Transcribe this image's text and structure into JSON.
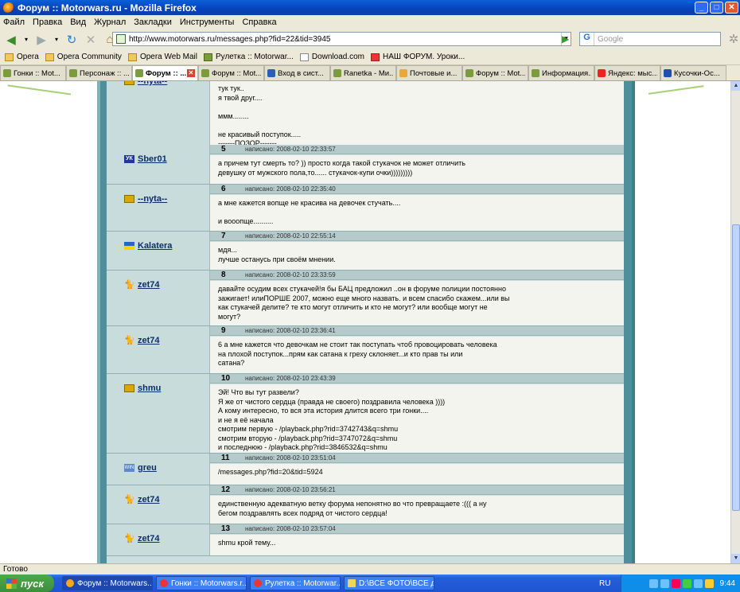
{
  "window": {
    "title": "Форум :: Motorwars.ru - Mozilla Firefox",
    "min": "_",
    "max": "□",
    "close": "✕"
  },
  "menu": [
    "Файл",
    "Правка",
    "Вид",
    "Журнал",
    "Закладки",
    "Инструменты",
    "Справка"
  ],
  "nav": {
    "url": "http://www.motorwars.ru/messages.php?fid=22&tid=3945",
    "search_placeholder": "Google",
    "search_engine": "G"
  },
  "bookmarks": [
    "Opera",
    "Opera Community",
    "Opera Web Mail",
    "Рулетка :: Motorwar...",
    "Download.com",
    "НАШ ФОРУМ. Уроки..."
  ],
  "tabs": [
    "Гонки :: Mot...",
    "Персонаж :: ...",
    "Форум :: ...",
    "Форум :: Mot...",
    "Вход в сист...",
    "Ranetka - Ми...",
    "Почтовые и...",
    "Форум :: Mot...",
    "Информация...",
    "Яндекс: мыс...",
    "Кусочки-Ос..."
  ],
  "posts": [
    {
      "user": "--nyta--",
      "flag": "u",
      "num": "",
      "date": "",
      "lines": [
        "тук тук..",
        "я твой друг....",
        "",
        "ммм........",
        "",
        "не красивый поступок.....",
        "-------ПОЗОР-------"
      ]
    },
    {
      "user": "Sber01",
      "flag": "uk",
      "num": "5",
      "date": "написано: 2008-02-10 22:33:57",
      "lines": [
        "а причем тут смерть то? )) просто когда такой стукачок не может отличить",
        "девушку от мужского пола,то...... стукачок-купи очки)))))))))"
      ]
    },
    {
      "user": "--nyta--",
      "flag": "u",
      "num": "6",
      "date": "написано: 2008-02-10 22:35:40",
      "lines": [
        "а мне кажется вопще не красива на девочек стучать....",
        "",
        "и вооопще.........."
      ]
    },
    {
      "user": "Kalatera",
      "flag": "ua",
      "num": "7",
      "date": "написано: 2008-02-10 22:55:14",
      "lines": [
        "мдя...",
        "лучше останусь при своём мнении."
      ]
    },
    {
      "user": "zet74",
      "flag": "cat",
      "num": "8",
      "date": "написано: 2008-02-10 23:33:59",
      "lines": [
        "давайте осудим всех стукачей!я бы БАЦ предложил ..он в форуме полиции постоянно",
        "зажигает! илиПОРШЕ 2007, можно еще много назвать. и всем спасибо скажем...или вы",
        "как стукачей делите? те кто могут отличить и кто не могут? или вообще могут не",
        "могут?"
      ]
    },
    {
      "user": "zet74",
      "flag": "cat",
      "num": "9",
      "date": "написано: 2008-02-10 23:36:41",
      "lines": [
        "6 а мне кажется что девочкам не стоит так поступать чтоб провоцировать человека",
        "на плохой поступок...прям как сатана к греху склоняет...и кто прав ты или",
        "сатана?"
      ]
    },
    {
      "user": "shmu",
      "flag": "u",
      "num": "10",
      "date": "написано: 2008-02-10 23:43:39",
      "lines": [
        "Эй! Что вы тут развели?",
        "Я же от чистого сердца (правда не своего) поздравила человека ))))",
        "А кому интересно, то вся эта история длится всего три гонки....",
        "и не я её начала",
        "смотрим первую - /playback.php?rid=3742743&q=shmu",
        "смотрим вторую - /playback.php?rid=3747072&q=shmu",
        "и последнюю - /playback.php?rid=3846532&q=shmu"
      ]
    },
    {
      "user": "greu",
      "flag": "win",
      "num": "11",
      "date": "написано: 2008-02-10 23:51:04",
      "lines": [
        "/messages.php?fid=20&tid=5924"
      ]
    },
    {
      "user": "zet74",
      "flag": "cat",
      "num": "12",
      "date": "написано: 2008-02-10 23:56:21",
      "lines": [
        "единственную адекватную ветку форума непонятно во что превращаете :((( а ну",
        "бегом поздравлять всех подряд от чистого сердца!"
      ]
    },
    {
      "user": "zet74",
      "flag": "cat",
      "num": "13",
      "date": "написано: 2008-02-10 23:57:04",
      "lines": [
        "shmu крой тему..."
      ]
    }
  ],
  "status": "Готово",
  "taskbar": {
    "start": "пуск",
    "items": [
      "Форум :: Motorwars....",
      "Гонки :: Motorwars.r...",
      "Рулетка :: Motorwar...",
      "D:\\ВСЕ ФОТО\\ВСЕ д..."
    ],
    "lang": "RU",
    "clock": "9:44"
  }
}
